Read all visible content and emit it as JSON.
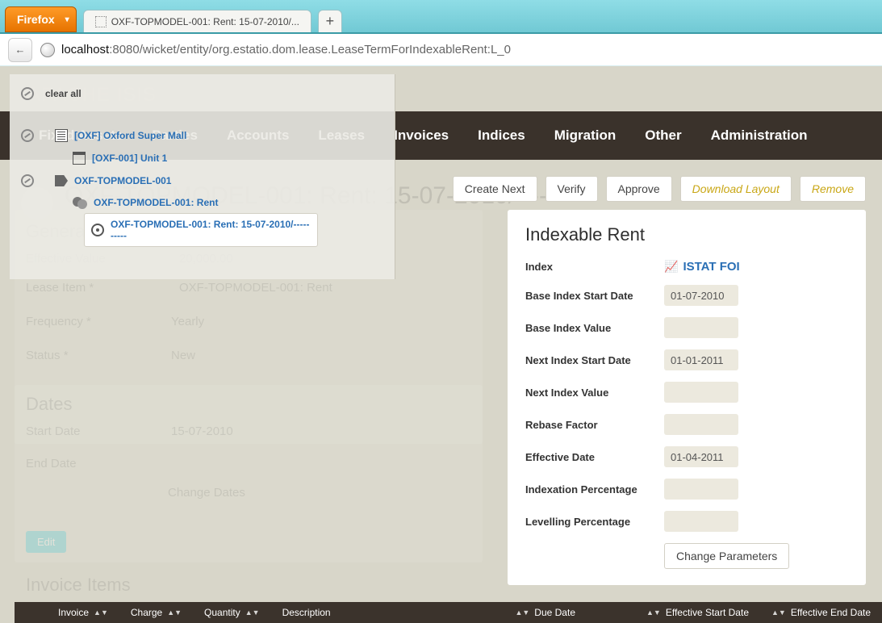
{
  "browser": {
    "firefox_label": "Firefox",
    "tab_title": "OXF-TOPMODEL-001: Rent: 15-07-2010/...",
    "url_pre": "localhost",
    "url_post": ":8080/wicket/entity/org.estatio.dom.lease.LeaseTermForIndexableRent:L_0"
  },
  "brand": "APACHE ISIS",
  "page_title": "OXF-TOPMODEL-001: Rent: 15-07-2010/----------",
  "top_nav": [
    "Fixed Assets",
    "Parties",
    "Accounts",
    "Leases",
    "Invoices",
    "Indices",
    "Migration",
    "Other",
    "Administration"
  ],
  "actions": {
    "create_next": "Create Next",
    "verify": "Verify",
    "approve": "Approve",
    "download_layout": "Download Layout",
    "remove": "Remove"
  },
  "tree": {
    "clear_all": "clear all",
    "n0": "[OXF] Oxford Super Mall",
    "n1": "[OXF-001] Unit 1",
    "n2": "OXF-TOPMODEL-001",
    "n3": "OXF-TOPMODEL-001: Rent",
    "n4": "OXF-TOPMODEL-001: Rent: 15-07-2010/----------"
  },
  "ghost": {
    "general": "General",
    "effective_value": "Effective Value",
    "effective_value_val": "20,000.00",
    "lease_item": "Lease Item *",
    "lease_item_val": "OXF-TOPMODEL-001: Rent",
    "frequency": "Frequency *",
    "frequency_val": "Yearly",
    "status": "Status *",
    "status_val": "New",
    "dates": "Dates",
    "start_date": "Start Date",
    "start_date_val": "15-07-2010",
    "end_date": "End Date",
    "change_dates": "Change Dates",
    "edit": "Edit",
    "invoice_items": "Invoice Items"
  },
  "card": {
    "title": "Indexable Rent",
    "index_label": "Index",
    "index_link": "ISTAT FOI",
    "base_start_label": "Base Index Start Date",
    "base_start_val": "01-07-2010",
    "base_value_label": "Base Index Value",
    "base_value_val": "",
    "next_start_label": "Next Index Start Date",
    "next_start_val": "01-01-2011",
    "next_value_label": "Next Index Value",
    "next_value_val": "",
    "rebase_label": "Rebase Factor",
    "rebase_val": "",
    "eff_date_label": "Effective Date",
    "eff_date_val": "01-04-2011",
    "ind_pct_label": "Indexation Percentage",
    "ind_pct_val": "",
    "lev_pct_label": "Levelling Percentage",
    "lev_pct_val": "",
    "change_params": "Change Parameters"
  },
  "table": {
    "cols": [
      "Invoice",
      "Charge",
      "Quantity",
      "Description",
      "Due Date",
      "Effective Start Date",
      "Effective End Date"
    ]
  }
}
